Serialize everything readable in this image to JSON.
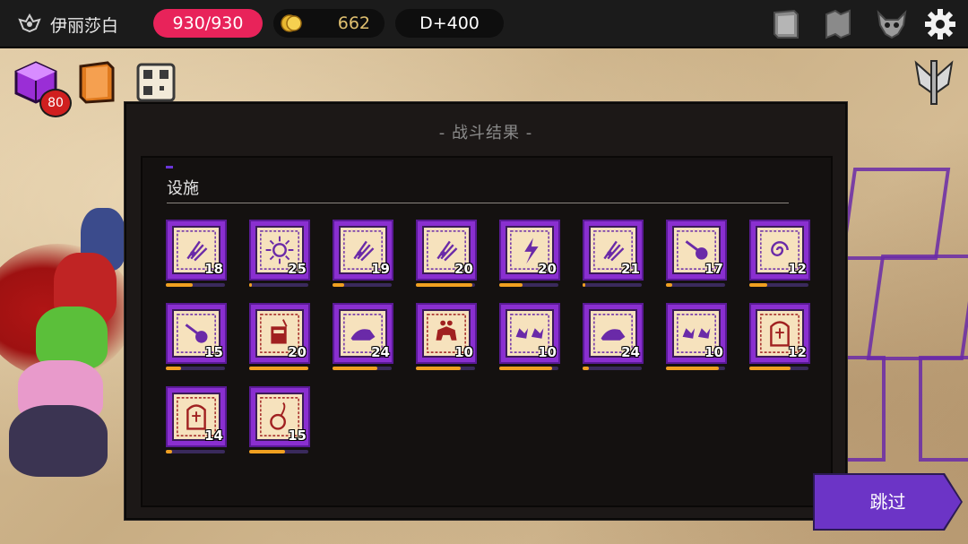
{
  "topbar": {
    "player_name": "伊丽莎白",
    "hp": "930/930",
    "gold": "662",
    "day": "D+400",
    "icons": [
      "player-crest-icon",
      "coin-icon",
      "book-icon",
      "scroll-map-icon",
      "demon-skull-icon",
      "settings-gear-icon"
    ]
  },
  "items": {
    "cube_count": "80",
    "icons": [
      "magic-cube-icon",
      "spellbook-icon",
      "qr-scroll-icon",
      "winged-sword-emblem-icon"
    ]
  },
  "dialog": {
    "title": "- 战斗结果 -",
    "section": "设施",
    "cards": [
      {
        "icon": "lightning-rune-icon",
        "level": "18",
        "progress": 0.45,
        "style": "purple"
      },
      {
        "icon": "sun-rune-icon",
        "level": "25",
        "progress": 0.05,
        "style": "purple"
      },
      {
        "icon": "lightning-rune-icon",
        "level": "19",
        "progress": 0.2,
        "style": "purple"
      },
      {
        "icon": "lightning-rune-icon",
        "level": "20",
        "progress": 0.95,
        "style": "purple"
      },
      {
        "icon": "bolt-rune-icon",
        "level": "20",
        "progress": 0.4,
        "style": "purple"
      },
      {
        "icon": "lightning-rune-icon",
        "level": "21",
        "progress": 0.05,
        "style": "purple"
      },
      {
        "icon": "comet-rune-icon",
        "level": "17",
        "progress": 0.1,
        "style": "purple"
      },
      {
        "icon": "spiral-rune-icon",
        "level": "12",
        "progress": 0.3,
        "style": "purple"
      },
      {
        "icon": "comet-rune-icon",
        "level": "15",
        "progress": 0.25,
        "style": "purple"
      },
      {
        "icon": "drink-cup-icon",
        "level": "20",
        "progress": 1.0,
        "style": "red"
      },
      {
        "icon": "hedgehog-icon",
        "level": "24",
        "progress": 0.75,
        "style": "purple"
      },
      {
        "icon": "beast-icon",
        "level": "10",
        "progress": 0.75,
        "style": "red"
      },
      {
        "icon": "twin-creature-icon",
        "level": "10",
        "progress": 0.9,
        "style": "purple"
      },
      {
        "icon": "hedgehog-icon",
        "level": "24",
        "progress": 0.1,
        "style": "purple"
      },
      {
        "icon": "twin-creature-icon",
        "level": "10",
        "progress": 0.9,
        "style": "purple"
      },
      {
        "icon": "tombstone-icon",
        "level": "12",
        "progress": 0.7,
        "style": "red"
      },
      {
        "icon": "tombstone-icon",
        "level": "14",
        "progress": 0.1,
        "style": "red"
      },
      {
        "icon": "bomb-icon",
        "level": "15",
        "progress": 0.6,
        "style": "red"
      }
    ]
  },
  "skip_label": "跳过",
  "colors": {
    "hp": "#e8235a",
    "card_border": "#8a2fd0",
    "card_face": "#f6e2bd",
    "progress_fill": "#f0a020",
    "progress_track": "#3a2a5c",
    "skip": "#6c34c6"
  }
}
